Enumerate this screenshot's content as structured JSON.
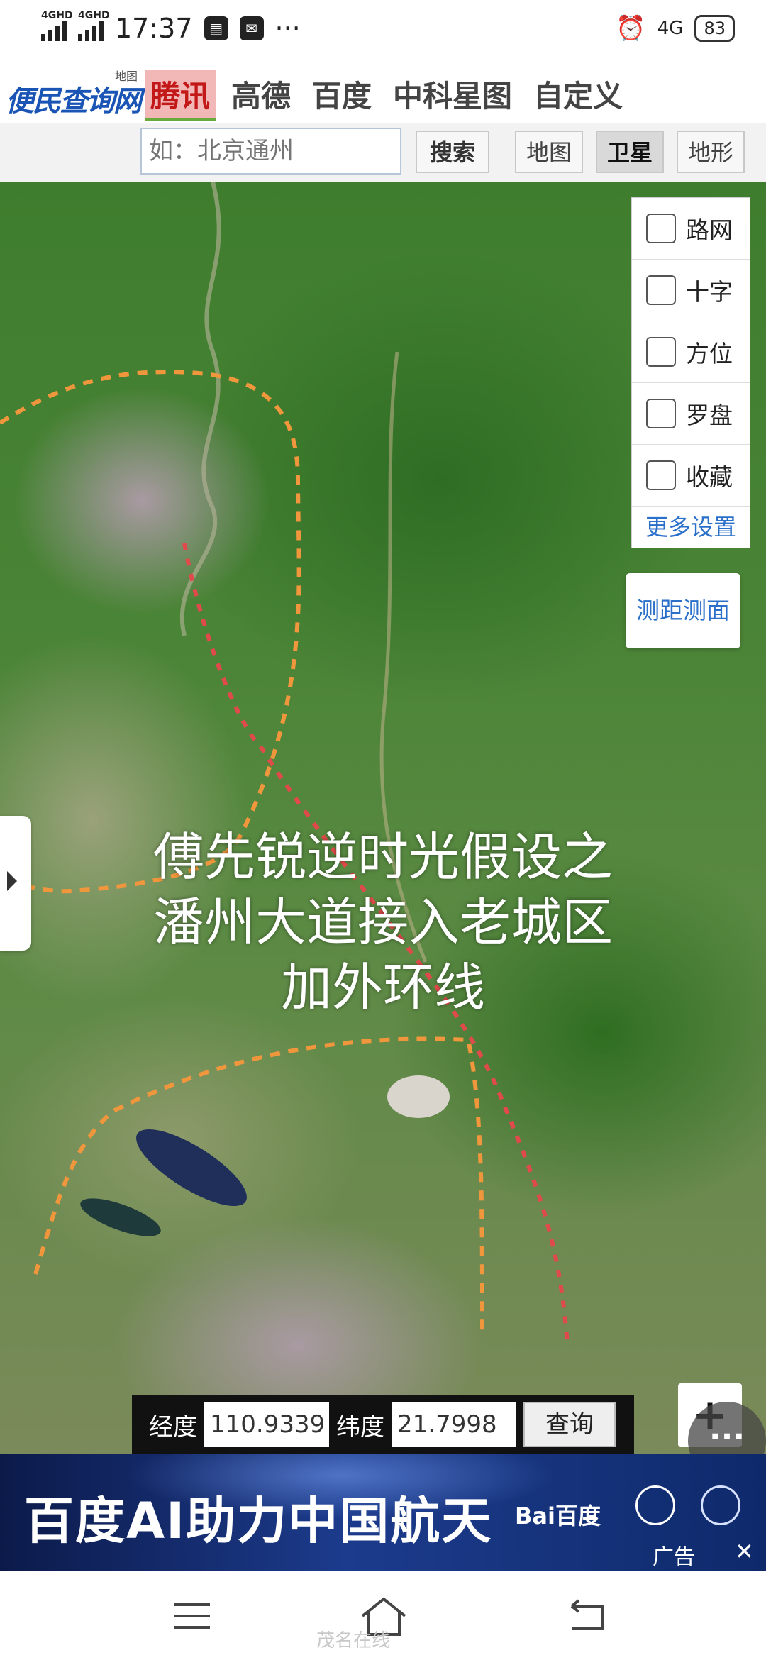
{
  "status_bar": {
    "signal_1": "4GHD",
    "signal_2": "4GHD",
    "time": "17:37",
    "more": "···",
    "network": "4G",
    "battery": "83"
  },
  "header": {
    "logo_text": "便民查询网",
    "logo_sub": "地图",
    "tabs": [
      "腾讯",
      "高德",
      "百度",
      "中科星图",
      "自定义"
    ]
  },
  "search": {
    "placeholder": "如：北京通州",
    "search_button": "搜索",
    "view_map": "地图",
    "view_satellite": "卫星",
    "view_terrain": "地形"
  },
  "layers": {
    "items": [
      "路网",
      "十字",
      "方位",
      "罗盘",
      "收藏"
    ],
    "more_settings": "更多设置"
  },
  "measure_button": "测距测面",
  "map_caption": {
    "line1": "傅先锐逆时光假设之",
    "line2": "潘州大道接入老城区",
    "line3": "加外环线"
  },
  "coordinates": {
    "longitude_label": "经度",
    "longitude_value": "110.9339",
    "latitude_label": "纬度",
    "latitude_value": "21.7998",
    "query_button": "查询"
  },
  "zoom": {
    "in": "+"
  },
  "floating_more": "···",
  "ad": {
    "headline": "百度AI助力中国航天",
    "brand": "Bai百度",
    "label": "广告",
    "close": "✕"
  },
  "watermark": "茂名在线",
  "colors": {
    "accent_blue": "#2a6fc9",
    "active_tab_bg": "#f2b8b8",
    "active_tab_text": "#c31818",
    "route_orange": "#f0963c",
    "route_red": "#e04a4a",
    "ad_bg": "#1c3b8c"
  },
  "icons": {
    "menu": "menu-icon",
    "home": "home-icon",
    "back": "back-icon",
    "alarm": "alarm-icon"
  }
}
